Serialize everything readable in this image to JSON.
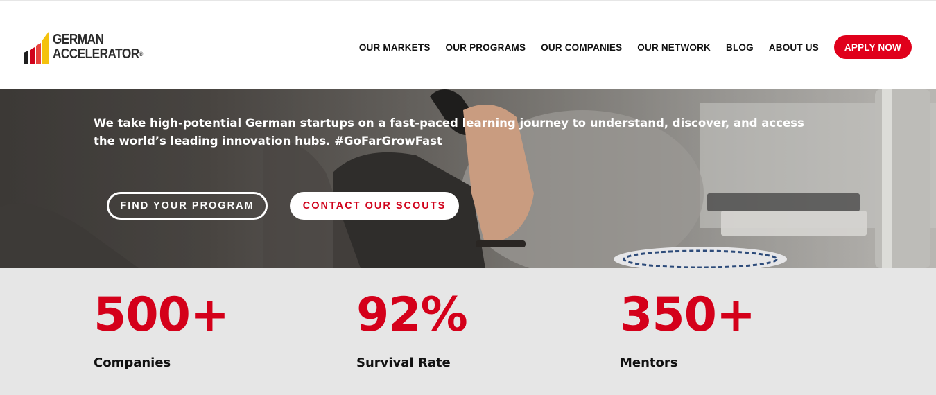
{
  "brand": {
    "line1": "GERMAN",
    "line2": "ACCELERATOR",
    "registered": "®",
    "colors": {
      "black": "#1f1f1f",
      "red": "#d0021b",
      "yellow": "#f4c20d"
    }
  },
  "nav": {
    "items": [
      {
        "label": "OUR MARKETS"
      },
      {
        "label": "OUR PROGRAMS"
      },
      {
        "label": "OUR COMPANIES"
      },
      {
        "label": "OUR NETWORK"
      },
      {
        "label": "BLOG"
      },
      {
        "label": "ABOUT US"
      }
    ],
    "cta": "APPLY NOW"
  },
  "hero": {
    "text": "We take high-potential German startups on a fast-paced learning journey to understand, discover, and access the world’s leading innovation hubs. #GoFarGrowFast",
    "primary_button": "FIND YOUR PROGRAM",
    "secondary_button": "CONTACT OUR SCOUTS"
  },
  "stats": [
    {
      "value": "500+",
      "label": "Companies"
    },
    {
      "value": "92%",
      "label": "Survival Rate"
    },
    {
      "value": "350+",
      "label": "Mentors"
    }
  ],
  "accent_color": "#e0001b"
}
